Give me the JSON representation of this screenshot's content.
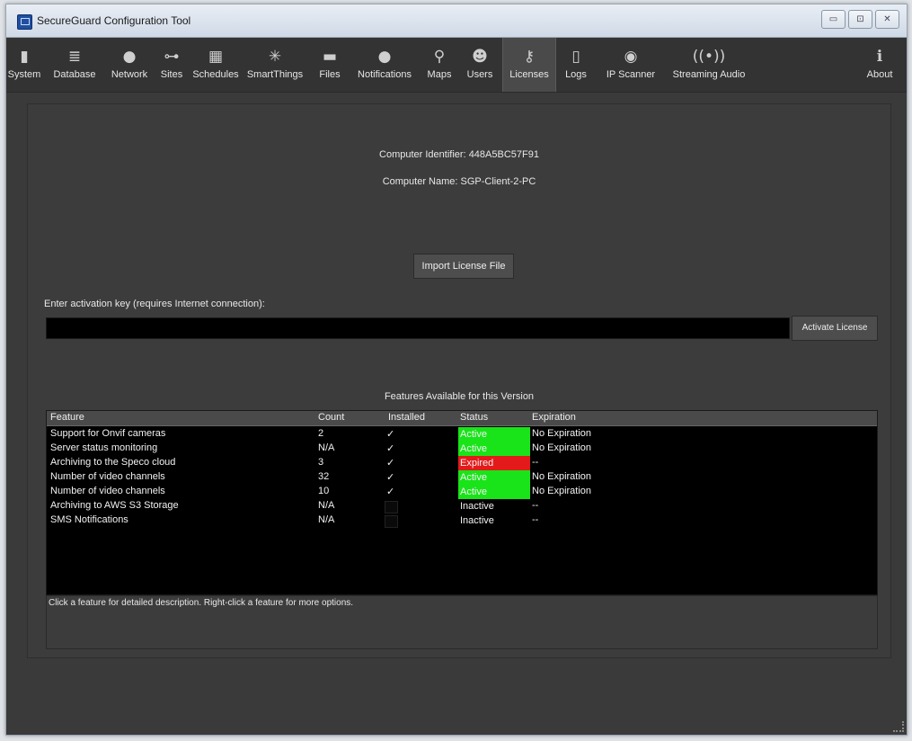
{
  "window": {
    "title": "SecureGuard Configuration Tool",
    "controls": {
      "minimize": "▭",
      "maximize": "⊡",
      "close": "✕"
    }
  },
  "toolbar": {
    "items": [
      {
        "label": "System",
        "icon": "▮"
      },
      {
        "label": "Database",
        "icon": "≣"
      },
      {
        "label": "Network",
        "icon": "●"
      },
      {
        "label": "Sites",
        "icon": "⊶"
      },
      {
        "label": "Schedules",
        "icon": "▦"
      },
      {
        "label": "SmartThings",
        "icon": "✳"
      },
      {
        "label": "Files",
        "icon": "▬"
      },
      {
        "label": "Notifications",
        "icon": "●"
      },
      {
        "label": "Maps",
        "icon": "⚲"
      },
      {
        "label": "Users",
        "icon": "☻"
      },
      {
        "label": "Licenses",
        "icon": "⚷"
      },
      {
        "label": "Logs",
        "icon": "▯"
      },
      {
        "label": "IP Scanner",
        "icon": "◉"
      },
      {
        "label": "Streaming Audio",
        "icon": "((•))"
      },
      {
        "label": "About",
        "icon": "ℹ"
      }
    ],
    "active": "Licenses"
  },
  "licenses": {
    "computer_identifier_label": "Computer Identifier:",
    "computer_identifier": "448A5BC57F91",
    "computer_name_label": "Computer Name:",
    "computer_name": "SGP-Client-2-PC",
    "import_button": "Import License File",
    "activation_label": "Enter activation key (requires Internet connection):",
    "activation_value": "",
    "activate_button": "Activate License",
    "table_title": "Features Available for this Version",
    "columns": [
      "Feature",
      "Count",
      "Installed",
      "Status",
      "Expiration"
    ],
    "rows": [
      {
        "feature": "Support for Onvif cameras",
        "count": "2",
        "installed": true,
        "status": "Active",
        "expiration": "No Expiration"
      },
      {
        "feature": "Server status monitoring",
        "count": "N/A",
        "installed": true,
        "status": "Active",
        "expiration": "No Expiration"
      },
      {
        "feature": "Archiving to the Speco cloud",
        "count": "3",
        "installed": true,
        "status": "Expired",
        "expiration": "--"
      },
      {
        "feature": "Number of video channels",
        "count": "32",
        "installed": true,
        "status": "Active",
        "expiration": "No Expiration"
      },
      {
        "feature": "Number of video channels",
        "count": "10",
        "installed": true,
        "status": "Active",
        "expiration": "No Expiration"
      },
      {
        "feature": "Archiving to AWS S3 Storage",
        "count": "N/A",
        "installed": false,
        "status": "Inactive",
        "expiration": "--"
      },
      {
        "feature": "SMS Notifications",
        "count": "N/A",
        "installed": false,
        "status": "Inactive",
        "expiration": "--"
      }
    ],
    "description_hint": "Click a feature for detailed description. Right-click a feature for more options."
  },
  "colors": {
    "active": "#19e419",
    "expired": "#e41a1a"
  }
}
